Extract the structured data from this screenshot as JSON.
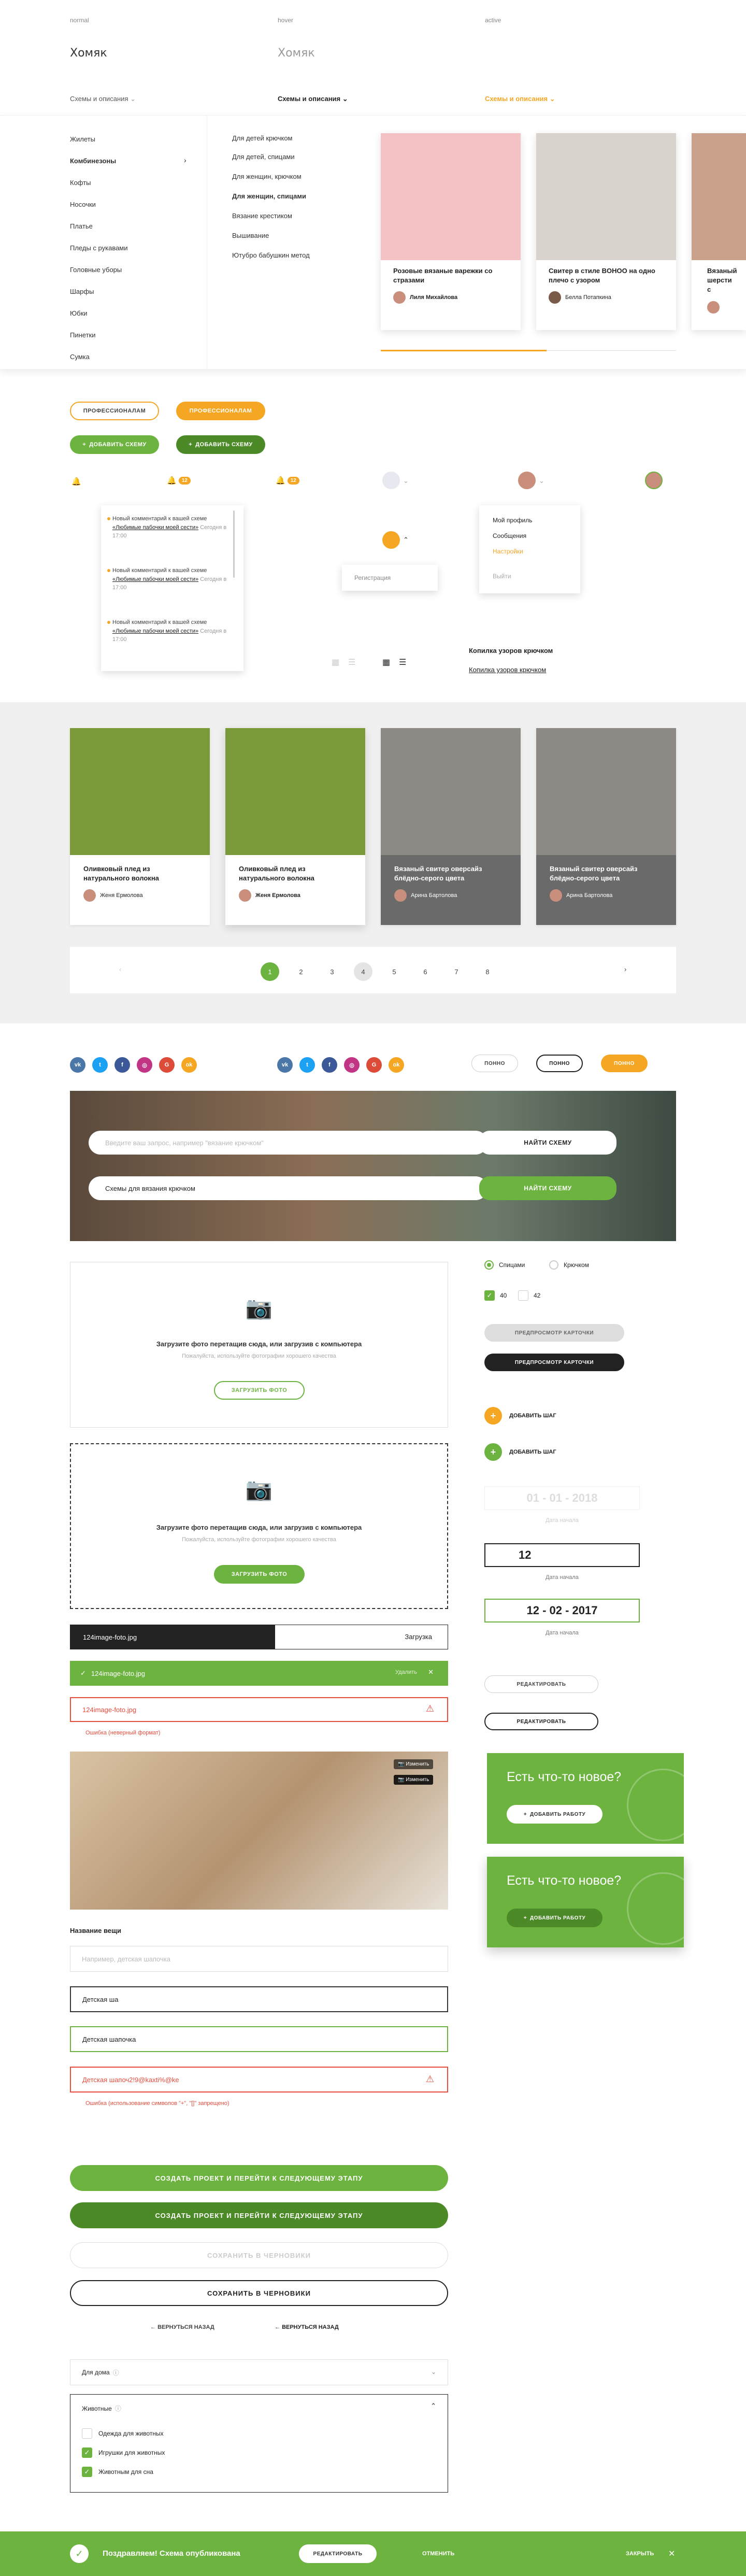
{
  "states": {
    "normal": "normal",
    "hover": "hover",
    "active": "active"
  },
  "logo": "Хомяк",
  "nav": {
    "schemes": "Схемы и описания"
  },
  "mega": {
    "col1": [
      "Жилеты",
      "Комбинезоны",
      "Кофты",
      "Носочки",
      "Платье",
      "Пледы с рукавами",
      "Головные уборы",
      "Шарфы",
      "Юбки",
      "Пинетки",
      "Сумка"
    ],
    "col2": [
      "Для детей крючком",
      "Для детей, спицами",
      "Для женщин, крючком",
      "Для женщин, спицами",
      "Вязание крестиком",
      "Вышивание",
      "Ютубро бабушкин метод"
    ],
    "cards": [
      {
        "title": "Розовые вязаные варежки со стразами",
        "author": "Лиля Михайлова"
      },
      {
        "title": "Свитер в стиле BOHOO на одно плечо с узором",
        "author": "Белла Потапкина"
      },
      {
        "title": "Вязаный шерсти с",
        "author": "..."
      }
    ]
  },
  "buttons": {
    "pro_outline": "Профессионалам",
    "pro_fill": "Профессионалам",
    "add_scheme": "Добавить схему",
    "add_scheme2": "Добавить схему"
  },
  "notif_badge": "12",
  "notifs": [
    {
      "text": "Новый комментарий к вашей схеме ",
      "link": "«Любимые пабочки моей сести»",
      "time": "Сегодня в 17:00"
    },
    {
      "text": "Новый комментарий к вашей схеме ",
      "link": "«Любимые пабочки моей сести»",
      "time": "Сегодня в 17:00"
    },
    {
      "text": "Новый комментарий к вашей схеме ",
      "link": "«Любимые пабочки моей сести»",
      "time": "Сегодня в 17:00"
    }
  ],
  "register": "Регистрация",
  "profile_menu": {
    "profile": "Мой профиль",
    "messages": "Сообщения",
    "settings": "Настройки",
    "logout": "Выйти"
  },
  "copy_link": "Копилка узоров крючком",
  "products": [
    {
      "title": "Оливковый плед из натурального волокна",
      "author": "Женя Ермолова"
    },
    {
      "title": "Оливковый плед из натурального волокна",
      "author": "Женя Ермолова"
    },
    {
      "title": "Вязаный свитер оверсайз блёдно-серого цвета",
      "author": "Арина Бартолова"
    },
    {
      "title": "Вязаный свитер оверсайз блёдно-серого цвета",
      "author": "Арина Бартолова"
    }
  ],
  "pages": [
    "1",
    "2",
    "3",
    "4",
    "5",
    "6",
    "7",
    "8"
  ],
  "pills_small": {
    "a": "Понно",
    "b": "Понно",
    "c": "Понно"
  },
  "hero": {
    "placeholder": "Введите ваш запрос, например \"вязание крючком\"",
    "value": "Схемы для вязания крючком",
    "find1": "Найти схему",
    "find2": "Найти схему"
  },
  "upload": {
    "title": "Загрузите фото перетащив сюда, или загрузив с компьютера",
    "sub": "Пожалуйста, используйте фотографии хорошего качества",
    "btn1": "Загрузить фото",
    "btn2": "Загрузить фото"
  },
  "file": {
    "name": "124image-foto.jpg",
    "loading": "Загрузка",
    "ok_name": "124image-foto.jpg",
    "delete": "Удалить",
    "err_name": "124image-foto.jpg",
    "err_msg": "Ошибка (неверный формат)"
  },
  "edit_badges": {
    "a": "Изменить",
    "b": "Изменить"
  },
  "form": {
    "label": "Название вещи",
    "placeholder": "Например, детская шапочка",
    "typing": "Детская ша",
    "done": "Детская шапочка",
    "error_val": "Детская шапоч2!9@kaxti%@ke",
    "error_msg": "Ошибка (использование символов \"+\", \"[]\" запрещено)"
  },
  "actions": {
    "create1": "Создать проект и перейти к следующему этапу",
    "create2": "Создать проект и перейти к следующему этапу",
    "draft1": "Сохранить в черновики",
    "draft2": "Сохранить в черновики",
    "back1": "Вернуться назад",
    "back2": "Вернуться назад"
  },
  "selects": {
    "home": "Для дома",
    "animals": "Животные",
    "opts": [
      "Одежда для животных",
      "Игрушки для животных",
      "Животным для сна"
    ]
  },
  "radios": {
    "knit": "Спицами",
    "crochet": "Крючком"
  },
  "checks": {
    "a": "40",
    "b": "42"
  },
  "preview": {
    "a": "Предпросмотр карточки",
    "b": "Предпросмотр карточки"
  },
  "steps": {
    "a": "Добавить шаг",
    "b": "Добавить шаг"
  },
  "dates": {
    "empty": "01 - 01 - 2018",
    "typing": "12",
    "full": "12 - 02 - 2017",
    "cap": "Дата начала"
  },
  "edit_btns": {
    "a": "Редактировать",
    "b": "Редактировать"
  },
  "promo": {
    "title": "Есть что-то новое?",
    "btn": "Добавить работу"
  },
  "bottom": {
    "msg": "Поздравляем! Схема опубликована",
    "edit": "Редактировать",
    "cancel": "Отменить",
    "close": "Закрыть"
  }
}
